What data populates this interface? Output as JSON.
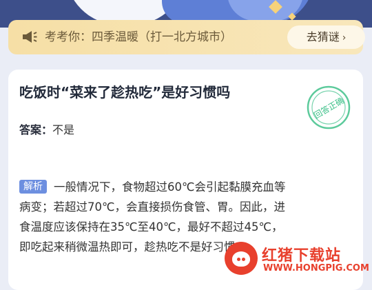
{
  "banner": {
    "quiz_text": "考考你：四季温暖（打一北方城市）",
    "button_label": "去猜谜",
    "button_chevron": "›",
    "icon": "megaphone-icon"
  },
  "card": {
    "question": "吃饭时“菜来了趁热吃”是好习惯吗",
    "stamp_text": "回答正确",
    "answer_label": "答案：",
    "answer_value": "不是",
    "explain_tag": "解析",
    "explain_lines": [
      "一般情况下，食物超过60℃会引起黏膜充血等",
      "病变；若超过70℃，会直接损伤食管、胃。因此，进",
      "食温度应该保持在35℃至40℃，最好不超过45℃，",
      "即吃起来稍微温热即可，趁热吃不是好习惯。"
    ]
  },
  "watermark": {
    "title": "红猪下载站",
    "url": "WWW.HONGPIG.COM"
  },
  "colors": {
    "accent": "#6d8fe0",
    "stamp": "#3fc18a",
    "banner_bg": "#f6dfa6",
    "watermark": "#e8402d"
  }
}
